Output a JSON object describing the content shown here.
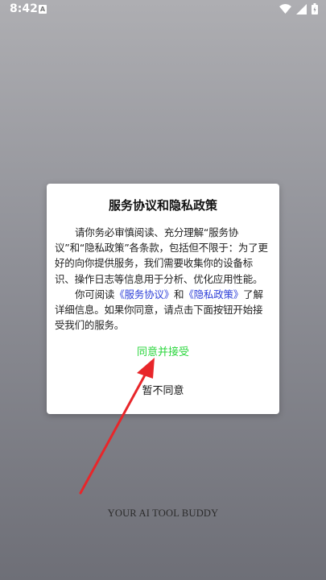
{
  "status_bar": {
    "time": "8:42",
    "notification_icon": "A",
    "icons": [
      "wifi-icon",
      "signal-icon",
      "battery-icon"
    ]
  },
  "dialog": {
    "title": "服务协议和隐私政策",
    "para1": "请你务必审慎阅读、充分理解“服务协议”和“隐私政策”各条款，包括但不限于：为了更好的向你提供服务，我们需要收集你的设备标识、操作日志等信息用于分析、优化应用性能。",
    "para2_prefix": "你可阅读",
    "service_link": "《服务协议》",
    "para2_and": "和",
    "privacy_link": "《隐私政策》",
    "para2_suffix": "了解详细信息。如果你同意，请点击下面按钮开始接受我们的服务。",
    "agree_label": "同意并接受",
    "disagree_label": "暂不同意"
  },
  "tagline": "YOUR AI TOOL BUDDY",
  "colors": {
    "agree": "#2bd63d",
    "link": "#2d3fd8",
    "annotation_arrow": "#e8262a"
  },
  "annotation": {
    "type": "arrow",
    "points_to": "agree-button"
  }
}
